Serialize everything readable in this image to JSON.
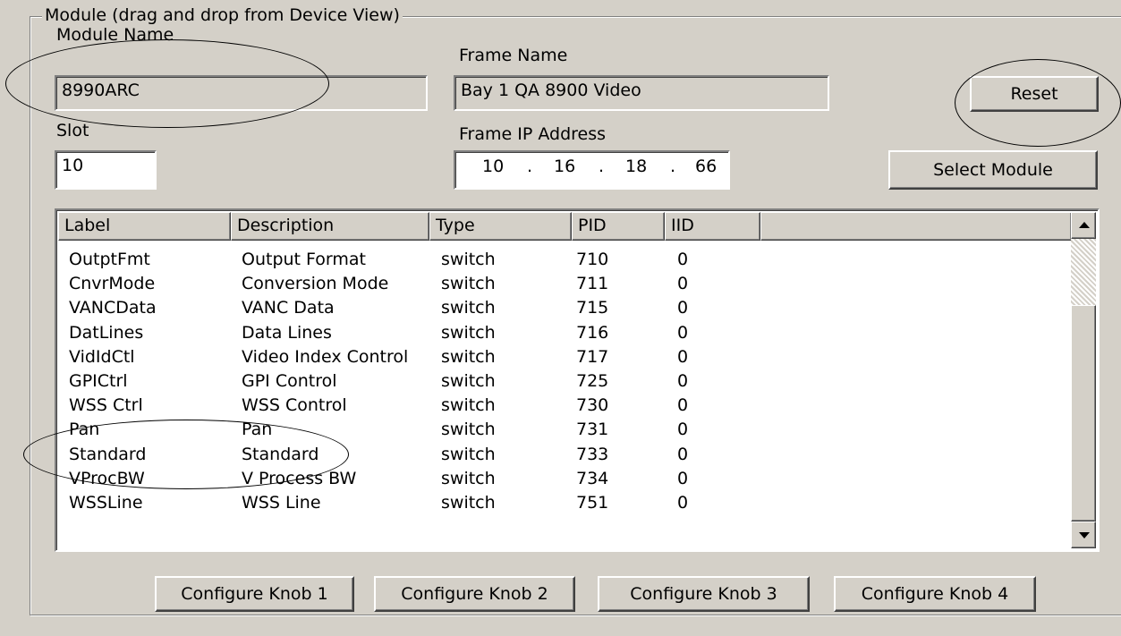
{
  "group": {
    "title": "Module (drag and drop from Device View)"
  },
  "module_name": {
    "label": "Module Name",
    "value": "8990ARC"
  },
  "frame_name": {
    "label": "Frame Name",
    "value": "Bay 1 QA 8900 Video"
  },
  "slot": {
    "label": "Slot",
    "value": "10"
  },
  "frame_ip": {
    "label": "Frame IP Address",
    "octets": [
      "10",
      "16",
      "18",
      "66"
    ],
    "dot": "."
  },
  "buttons": {
    "reset": "Reset",
    "select_module": "Select Module"
  },
  "table": {
    "columns": [
      "Label",
      "Description",
      "Type",
      "PID",
      "IID"
    ],
    "rows": [
      [
        "OutptFmt",
        "Output Format",
        "switch",
        "710",
        "0"
      ],
      [
        "CnvrMode",
        "Conversion Mode",
        "switch",
        "711",
        "0"
      ],
      [
        "VANCData",
        "VANC Data",
        "switch",
        "715",
        "0"
      ],
      [
        "DatLines",
        "Data Lines",
        "switch",
        "716",
        "0"
      ],
      [
        "VidIdCtl",
        "Video Index Control",
        "switch",
        "717",
        "0"
      ],
      [
        "GPICtrl",
        "GPI Control",
        "switch",
        "725",
        "0"
      ],
      [
        "WSS Ctrl",
        "WSS Control",
        "switch",
        "730",
        "0"
      ],
      [
        "Pan",
        "Pan",
        "switch",
        "731",
        "0"
      ],
      [
        "Standard",
        "Standard",
        "switch",
        "733",
        "0"
      ],
      [
        "VProcBW",
        "V Process BW",
        "switch",
        "734",
        "0"
      ],
      [
        "WSSLine",
        "WSS Line",
        "switch",
        "751",
        "0"
      ]
    ]
  },
  "knobs": [
    "Configure Knob 1",
    "Configure Knob 2",
    "Configure Knob 3",
    "Configure Knob 4"
  ]
}
